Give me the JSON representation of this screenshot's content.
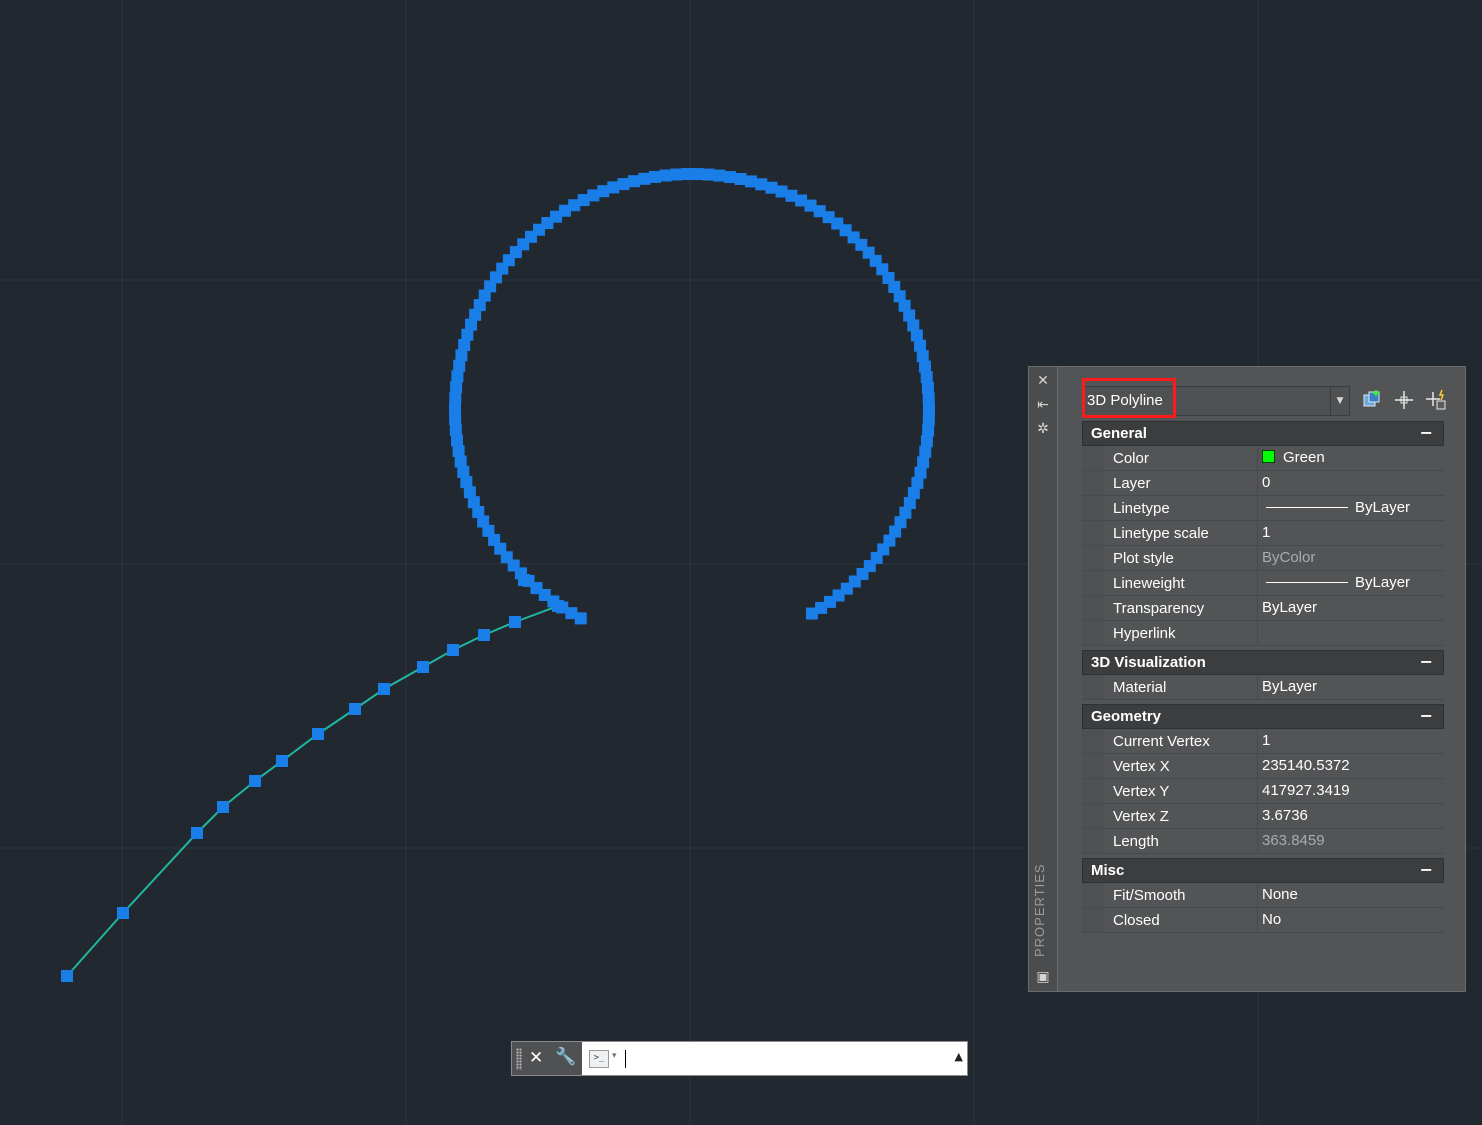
{
  "canvas": {
    "background": "#212830",
    "grid_color": "#2b3440",
    "polyline_color": "#1fb7a0",
    "grip_color": "#1a7ee8"
  },
  "palette": {
    "vertical_label": "PROPERTIES",
    "side_icons": [
      "close-icon",
      "auto-hide-icon",
      "settings-icon",
      "palette-menu-icon"
    ],
    "object_type": "3D Polyline",
    "toolbar": [
      "toggle-pickadd-icon",
      "select-objects-icon",
      "quick-select-icon"
    ],
    "sections": [
      {
        "title": "General",
        "toggle": "−",
        "rows": [
          {
            "name": "Color",
            "value": "Green",
            "swatch": "#00ff00"
          },
          {
            "name": "Layer",
            "value": "0"
          },
          {
            "name": "Linetype",
            "value": "ByLayer",
            "line_sample": true
          },
          {
            "name": "Linetype scale",
            "value": "1"
          },
          {
            "name": "Plot style",
            "value": "ByColor",
            "dim": true
          },
          {
            "name": "Lineweight",
            "value": "ByLayer",
            "line_sample": true
          },
          {
            "name": "Transparency",
            "value": "ByLayer"
          },
          {
            "name": "Hyperlink",
            "value": ""
          }
        ]
      },
      {
        "title": "3D Visualization",
        "toggle": "−",
        "rows": [
          {
            "name": "Material",
            "value": "ByLayer"
          }
        ]
      },
      {
        "title": "Geometry",
        "toggle": "−",
        "rows": [
          {
            "name": "Current Vertex",
            "value": "1"
          },
          {
            "name": "Vertex X",
            "value": "235140.5372"
          },
          {
            "name": "Vertex Y",
            "value": "417927.3419"
          },
          {
            "name": "Vertex Z",
            "value": "3.6736"
          },
          {
            "name": "Length",
            "value": "363.8459",
            "dim": true
          }
        ]
      },
      {
        "title": "Misc",
        "toggle": "−",
        "rows": [
          {
            "name": "Fit/Smooth",
            "value": "None"
          },
          {
            "name": "Closed",
            "value": "No"
          }
        ]
      }
    ]
  },
  "command_line": {
    "input_value": ""
  }
}
